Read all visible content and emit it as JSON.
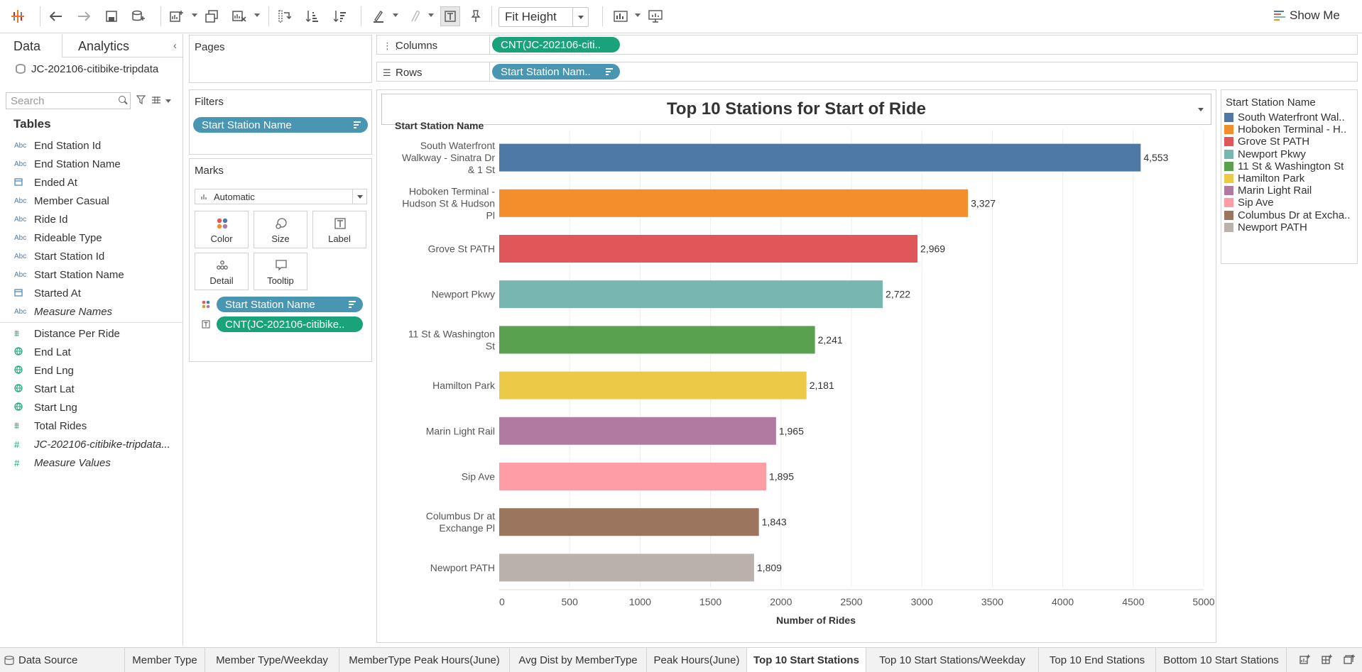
{
  "toolbar": {
    "fit_label": "Fit Height",
    "show_me_label": "Show Me"
  },
  "data_pane": {
    "tab_data": "Data",
    "tab_analytics": "Analytics",
    "datasource": "JC-202106-citibike-tripdata",
    "search_placeholder": "Search",
    "tables_heading": "Tables",
    "dimensions": [
      {
        "type": "Abc",
        "name": "End Station Id"
      },
      {
        "type": "Abc",
        "name": "End Station Name"
      },
      {
        "type": "date",
        "name": "Ended At"
      },
      {
        "type": "Abc",
        "name": "Member Casual"
      },
      {
        "type": "Abc",
        "name": "Ride Id"
      },
      {
        "type": "Abc",
        "name": "Rideable Type"
      },
      {
        "type": "Abc",
        "name": "Start Station Id"
      },
      {
        "type": "Abc",
        "name": "Start Station Name"
      },
      {
        "type": "date",
        "name": "Started At"
      },
      {
        "type": "Abc",
        "name": "Measure Names",
        "italic": true
      }
    ],
    "measures": [
      {
        "type": "#",
        "name": "Distance Per Ride"
      },
      {
        "type": "geo",
        "name": "End Lat"
      },
      {
        "type": "geo",
        "name": "End Lng"
      },
      {
        "type": "geo",
        "name": "Start Lat"
      },
      {
        "type": "geo",
        "name": "Start Lng"
      },
      {
        "type": "#",
        "name": "Total Rides"
      },
      {
        "type": "=#",
        "name": "JC-202106-citibike-tripdata...",
        "italic": true
      },
      {
        "type": "=#",
        "name": "Measure Values",
        "italic": true
      }
    ]
  },
  "cards": {
    "pages_title": "Pages",
    "filters_title": "Filters",
    "filter_pill": "Start Station Name",
    "marks_title": "Marks",
    "marks_type": "Automatic",
    "mark_buttons": [
      "Color",
      "Size",
      "Label",
      "Detail",
      "Tooltip"
    ],
    "marks_color_pill": "Start Station Name",
    "marks_label_pill": "CNT(JC-202106-citibike.."
  },
  "shelves": {
    "columns_label": "Columns",
    "columns_pill": "CNT(JC-202106-citi..",
    "rows_label": "Rows",
    "rows_pill": "Start Station Nam.."
  },
  "legend": {
    "title": "Start Station Name",
    "items": [
      {
        "label": "South Waterfront Wal..",
        "color": "#4e79a7"
      },
      {
        "label": "Hoboken Terminal - H..",
        "color": "#f28e2b"
      },
      {
        "label": "Grove St PATH",
        "color": "#e15759"
      },
      {
        "label": "Newport Pkwy",
        "color": "#76b7b2"
      },
      {
        "label": "11 St & Washington St",
        "color": "#59a14f"
      },
      {
        "label": "Hamilton Park",
        "color": "#edc948"
      },
      {
        "label": "Marin Light Rail",
        "color": "#b07aa1"
      },
      {
        "label": "Sip Ave",
        "color": "#ff9da7"
      },
      {
        "label": "Columbus Dr at Excha..",
        "color": "#9c755f"
      },
      {
        "label": "Newport PATH",
        "color": "#bab0ac"
      }
    ]
  },
  "chart_data": {
    "type": "bar",
    "orientation": "horizontal",
    "title": "Top 10 Stations for Start of Ride",
    "row_header": "Start Station Name",
    "xlabel": "Number of Rides",
    "xlim": [
      0,
      5000
    ],
    "xticks": [
      0,
      500,
      1000,
      1500,
      2000,
      2500,
      3000,
      3500,
      4000,
      4500,
      5000
    ],
    "categories": [
      [
        "South Waterfront",
        "Walkway - Sinatra Dr",
        "& 1 St"
      ],
      [
        "Hoboken Terminal -",
        "Hudson St & Hudson",
        "Pl"
      ],
      [
        "Grove St PATH"
      ],
      [
        "Newport Pkwy"
      ],
      [
        "11 St & Washington",
        "St"
      ],
      [
        "Hamilton Park"
      ],
      [
        "Marin Light Rail"
      ],
      [
        "Sip Ave"
      ],
      [
        "Columbus Dr at",
        "Exchange Pl"
      ],
      [
        "Newport PATH"
      ]
    ],
    "values": [
      4553,
      3327,
      2969,
      2722,
      2241,
      2181,
      1965,
      1895,
      1843,
      1809
    ],
    "value_labels": [
      "4,553",
      "3,327",
      "2,969",
      "2,722",
      "2,241",
      "2,181",
      "1,965",
      "1,895",
      "1,843",
      "1,809"
    ],
    "colors": [
      "#4e79a7",
      "#f28e2b",
      "#e15759",
      "#76b7b2",
      "#59a14f",
      "#edc948",
      "#b07aa1",
      "#ff9da7",
      "#9c755f",
      "#bab0ac"
    ],
    "grid": "vertical",
    "legend": "right"
  },
  "sheet_tabs": {
    "data_source": "Data Source",
    "tabs": [
      "Member Type",
      "Member Type/Weekday",
      "MemberType Peak Hours(June)",
      "Avg Dist by MemberType",
      "Peak Hours(June)",
      "Top 10 Start Stations",
      "Top 10 Start Stations/Weekday",
      "Top 10 End Stations",
      "Bottom 10 Start Stations"
    ],
    "active_index": 5
  }
}
